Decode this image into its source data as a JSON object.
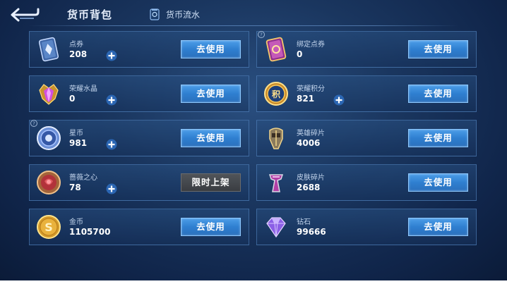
{
  "header": {
    "title": "货币背包",
    "flow_label": "货币流水"
  },
  "colors": {
    "accent_button": "#2f7fd0",
    "limited_button": "#3a3d42",
    "background": "#1a365f"
  },
  "currencies": [
    {
      "name": "点券",
      "value": "208",
      "icon": "ticket-card-icon",
      "has_plus": true,
      "has_help": false,
      "button": "去使用"
    },
    {
      "name": "绑定点券",
      "value": "0",
      "icon": "bound-ticket-card-icon",
      "has_plus": false,
      "has_help": true,
      "button": "去使用"
    },
    {
      "name": "荣耀水晶",
      "value": "0",
      "icon": "glory-crystal-icon",
      "has_plus": true,
      "has_help": false,
      "button": "去使用"
    },
    {
      "name": "荣耀积分",
      "value": "821",
      "icon": "glory-points-icon",
      "has_plus": true,
      "has_help": false,
      "button": "去使用"
    },
    {
      "name": "星币",
      "value": "981",
      "icon": "star-coin-icon",
      "has_plus": true,
      "has_help": true,
      "button": "去使用"
    },
    {
      "name": "英雄碎片",
      "value": "4006",
      "icon": "hero-fragment-icon",
      "has_plus": false,
      "has_help": false,
      "button": "去使用"
    },
    {
      "name": "蔷薇之心",
      "value": "78",
      "icon": "rose-heart-icon",
      "has_plus": true,
      "has_help": false,
      "button": "限时上架"
    },
    {
      "name": "皮肤碎片",
      "value": "2688",
      "icon": "skin-fragment-icon",
      "has_plus": false,
      "has_help": false,
      "button": "去使用"
    },
    {
      "name": "金币",
      "value": "1105700",
      "icon": "gold-coin-icon",
      "has_plus": false,
      "has_help": false,
      "button": "去使用"
    },
    {
      "name": "钻石",
      "value": "99666",
      "icon": "diamond-icon",
      "has_plus": false,
      "has_help": false,
      "button": "去使用"
    }
  ]
}
